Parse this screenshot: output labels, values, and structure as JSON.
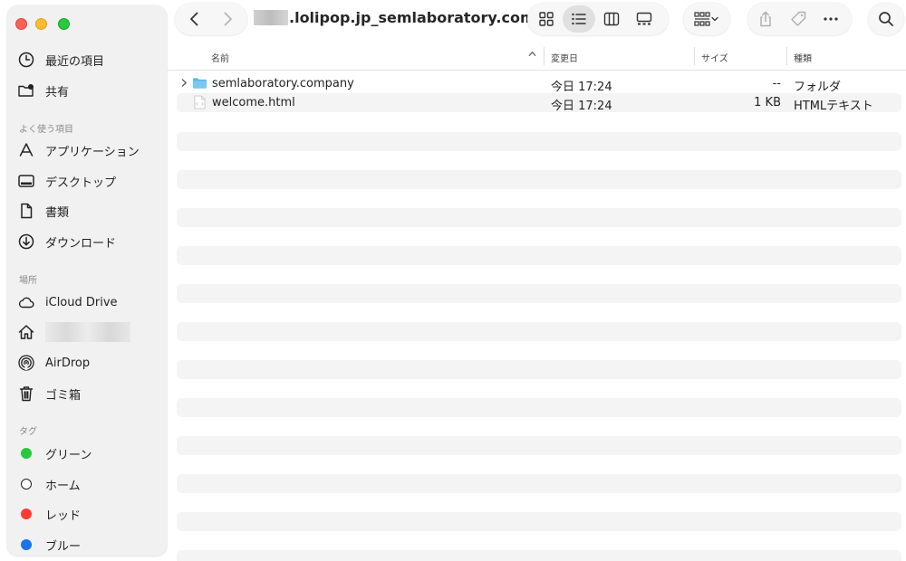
{
  "window": {
    "path_title": ".lolipop.jp_semlaboratory.comp..."
  },
  "sidebar": {
    "items_top": [
      {
        "label": "最近の項目",
        "icon": "clock-icon"
      },
      {
        "label": "共有",
        "icon": "shared-folder-icon"
      }
    ],
    "favorites_title": "よく使う項目",
    "favorites": [
      {
        "label": "アプリケーション",
        "icon": "applications-icon"
      },
      {
        "label": "デスクトップ",
        "icon": "desktop-icon"
      },
      {
        "label": "書類",
        "icon": "document-icon"
      },
      {
        "label": "ダウンロード",
        "icon": "download-icon"
      }
    ],
    "locations_title": "場所",
    "locations": [
      {
        "label": "iCloud Drive",
        "icon": "cloud-icon"
      },
      {
        "label": "",
        "icon": "home-icon"
      },
      {
        "label": "AirDrop",
        "icon": "airdrop-icon"
      },
      {
        "label": "ゴミ箱",
        "icon": "trash-icon"
      }
    ],
    "tags_title": "タグ",
    "tags": [
      {
        "label": "グリーン",
        "color": "#28c840"
      },
      {
        "label": "ホーム",
        "color": "#ffffff"
      },
      {
        "label": "レッド",
        "color": "#ff3b30"
      },
      {
        "label": "ブルー",
        "color": "#1a73e8"
      }
    ]
  },
  "columns": {
    "name": "名前",
    "modified": "変更日",
    "size": "サイズ",
    "kind": "種類"
  },
  "files": [
    {
      "name": "semlaboratory.company",
      "modified": "今日 17:24",
      "size": "--",
      "kind": "フォルダ",
      "icon": "folder-icon",
      "expandable": true
    },
    {
      "name": "welcome.html",
      "modified": "今日 17:24",
      "size": "1 KB",
      "kind": "HTMLテキスト",
      "icon": "html-file-icon",
      "expandable": false
    }
  ],
  "colors": {
    "folder": "#5cb8ea",
    "sidebar_bg": "#f1f1f1",
    "stripe": "#f4f4f4"
  }
}
